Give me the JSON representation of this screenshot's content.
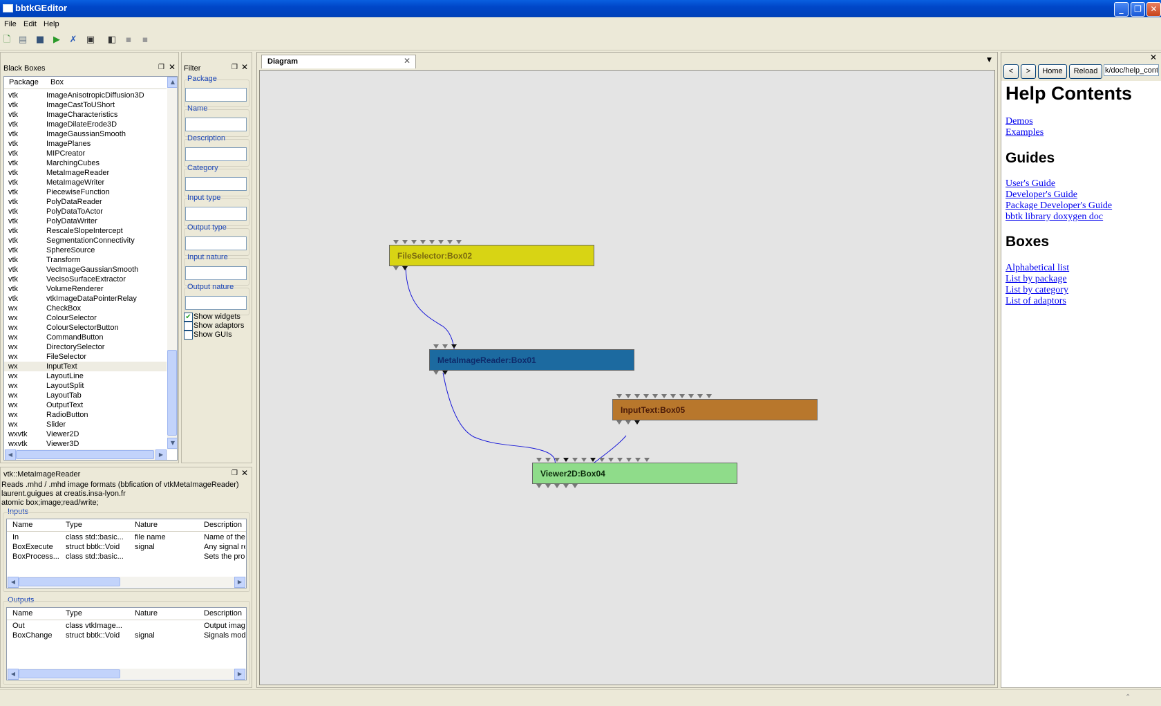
{
  "window": {
    "title": "bbtkGEditor",
    "minimize": "_",
    "maximize": "❐",
    "close": "✕"
  },
  "menu": [
    "File",
    "Edit",
    "Help"
  ],
  "black_boxes": {
    "title": "Black Boxes",
    "columns": [
      "Package",
      "Box"
    ],
    "rows": [
      [
        "vtk",
        "ImageAnisotropicDiffusion3D"
      ],
      [
        "vtk",
        "ImageCastToUShort"
      ],
      [
        "vtk",
        "ImageCharacteristics"
      ],
      [
        "vtk",
        "ImageDilateErode3D"
      ],
      [
        "vtk",
        "ImageGaussianSmooth"
      ],
      [
        "vtk",
        "ImagePlanes"
      ],
      [
        "vtk",
        "MIPCreator"
      ],
      [
        "vtk",
        "MarchingCubes"
      ],
      [
        "vtk",
        "MetaImageReader"
      ],
      [
        "vtk",
        "MetaImageWriter"
      ],
      [
        "vtk",
        "PiecewiseFunction"
      ],
      [
        "vtk",
        "PolyDataReader"
      ],
      [
        "vtk",
        "PolyDataToActor"
      ],
      [
        "vtk",
        "PolyDataWriter"
      ],
      [
        "vtk",
        "RescaleSlopeIntercept"
      ],
      [
        "vtk",
        "SegmentationConnectivity"
      ],
      [
        "vtk",
        "SphereSource"
      ],
      [
        "vtk",
        "Transform"
      ],
      [
        "vtk",
        "VecImageGaussianSmooth"
      ],
      [
        "vtk",
        "VecIsoSurfaceExtractor"
      ],
      [
        "vtk",
        "VolumeRenderer"
      ],
      [
        "vtk",
        "vtkImageDataPointerRelay"
      ],
      [
        "wx",
        "CheckBox"
      ],
      [
        "wx",
        "ColourSelector"
      ],
      [
        "wx",
        "ColourSelectorButton"
      ],
      [
        "wx",
        "CommandButton"
      ],
      [
        "wx",
        "DirectorySelector"
      ],
      [
        "wx",
        "FileSelector"
      ],
      [
        "wx",
        "InputText"
      ],
      [
        "wx",
        "LayoutLine"
      ],
      [
        "wx",
        "LayoutSplit"
      ],
      [
        "wx",
        "LayoutTab"
      ],
      [
        "wx",
        "OutputText"
      ],
      [
        "wx",
        "RadioButton"
      ],
      [
        "wx",
        "Slider"
      ],
      [
        "wxvtk",
        "Viewer2D"
      ],
      [
        "wxvtk",
        "Viewer3D"
      ]
    ],
    "selected_index": 28
  },
  "filter": {
    "title": "Filter",
    "fields": [
      "Package",
      "Name",
      "Description",
      "Category",
      "Input type",
      "Output type",
      "Input nature",
      "Output nature"
    ],
    "checkboxes": [
      {
        "label": "Show widgets",
        "checked": true
      },
      {
        "label": "Show adaptors",
        "checked": false
      },
      {
        "label": "Show GUIs",
        "checked": false
      }
    ]
  },
  "box_info": {
    "title": "vtk::MetaImageReader",
    "description": "Reads .mhd / .mhd image formats (bbfication of vtkMetaImageReader)",
    "author": "laurent.guigues at creatis.insa-lyon.fr",
    "category": "atomic box;image;read/write;",
    "inputs_label": "Inputs",
    "outputs_label": "Outputs",
    "columns": [
      "Name",
      "Type",
      "Nature",
      "Description"
    ],
    "inputs": [
      [
        "In",
        "class std::basic...",
        "file name",
        "Name of the"
      ],
      [
        "BoxExecute",
        "struct bbtk::Void",
        "signal",
        "Any signal re"
      ],
      [
        "BoxProcess...",
        "class std::basic...",
        "",
        "Sets the proc"
      ]
    ],
    "outputs": [
      [
        "Out",
        "class vtkImage...",
        "",
        "Output image"
      ],
      [
        "BoxChange",
        "struct bbtk::Void",
        "signal",
        "Signals modif"
      ]
    ]
  },
  "diagram": {
    "tab_label": "Diagram",
    "boxes": [
      {
        "id": "b2",
        "label": "FileSelector:Box02",
        "color": "#d8d414",
        "text": "#7a6a10"
      },
      {
        "id": "b1",
        "label": "MetaImageReader:Box01",
        "color": "#1c6aa0",
        "text": "#0e2a6a"
      },
      {
        "id": "b5",
        "label": "InputText:Box05",
        "color": "#b8772c",
        "text": "#4a1a08"
      },
      {
        "id": "b4",
        "label": "Viewer2D:Box04",
        "color": "#8fdc8a",
        "text": "#0b2a0b"
      }
    ],
    "link_color": "#1818d8",
    "canvas_color": "#e4e4e4"
  },
  "help": {
    "nav": [
      "<",
      ">",
      "Home",
      "Reload"
    ],
    "url": "k/doc/help_cont",
    "title": "Help Contents",
    "sections": [
      {
        "links": [
          "Demos",
          "Examples"
        ]
      },
      {
        "heading": "Guides",
        "links": [
          "User's Guide",
          "Developer's Guide",
          "Package Developer's Guide",
          "bbtk library doxygen doc"
        ]
      },
      {
        "heading": "Boxes",
        "links": [
          "Alphabetical list",
          "List by package",
          "List by category",
          "List of adaptors"
        ]
      }
    ]
  }
}
